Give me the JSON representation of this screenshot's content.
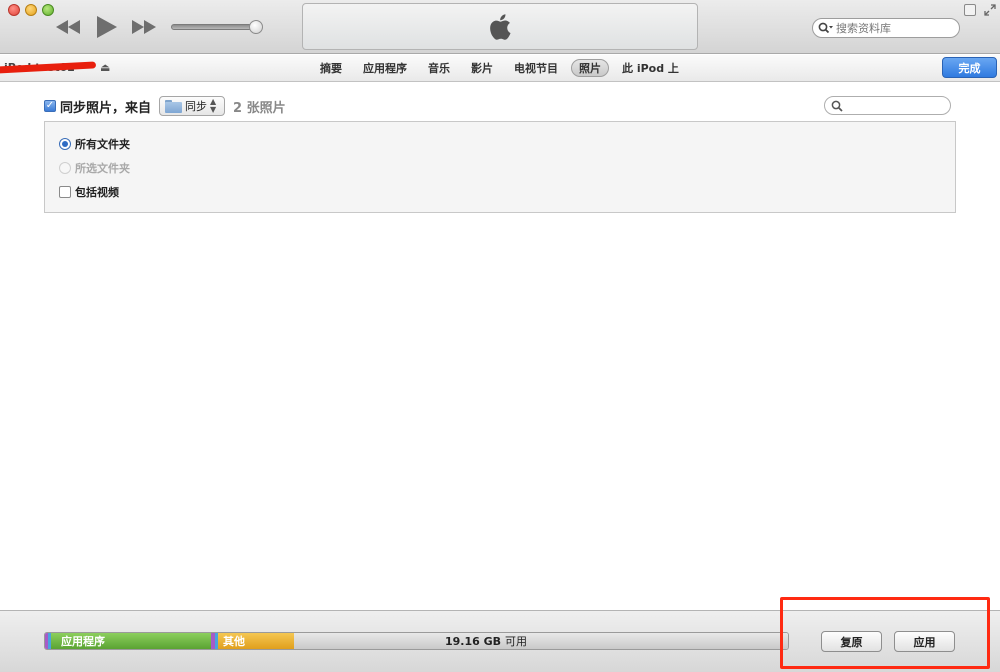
{
  "window": {
    "search_placeholder": "搜索资料库"
  },
  "device": {
    "name": "iPod test02",
    "eject_glyph": "⏏",
    "redaction_color": "#e81f0d"
  },
  "tabs": [
    {
      "label": "摘要",
      "active": false
    },
    {
      "label": "应用程序",
      "active": false
    },
    {
      "label": "音乐",
      "active": false
    },
    {
      "label": "影片",
      "active": false
    },
    {
      "label": "电视节目",
      "active": false
    },
    {
      "label": "照片",
      "active": true
    },
    {
      "label": "此 iPod 上",
      "active": false
    }
  ],
  "done_button": {
    "label": "完成",
    "color": "#2f7ae0"
  },
  "sync": {
    "checkbox_label": "同步照片，来自",
    "checked": true,
    "source_label": "同步",
    "count_label": "2 张照片"
  },
  "options": {
    "all_folders": "所有文件夹",
    "selected_folders": "所选文件夹",
    "include_videos": "包括视频"
  },
  "capacity": {
    "apps_label": "应用程序",
    "other_label": "其他",
    "free_amount": "19.16 GB",
    "free_label": "可用",
    "apps_color": "#5aa332",
    "other_color": "#e09f1c"
  },
  "buttons": {
    "revert": "复原",
    "apply": "应用"
  },
  "annotation": {
    "highlight_color": "#ff2a12"
  }
}
